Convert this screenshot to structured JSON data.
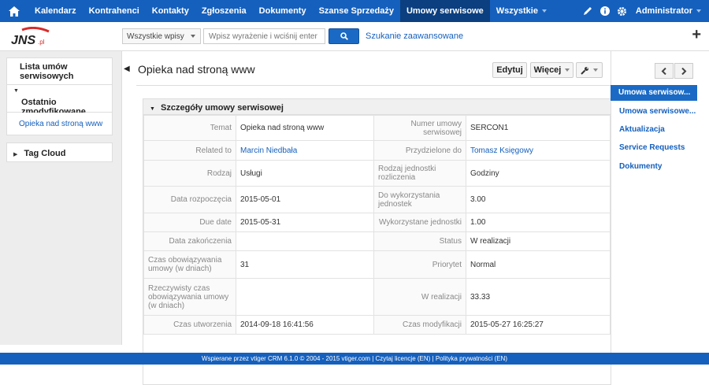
{
  "nav": {
    "items": [
      "Kalendarz",
      "Kontrahenci",
      "Kontakty",
      "Zgłoszenia",
      "Dokumenty",
      "Szanse Sprzedaży",
      "Umowy serwisowe",
      "Wszystkie"
    ],
    "active": "Umowy serwisowe",
    "admin": "Administrator"
  },
  "search": {
    "select_value": "Wszystkie wpisy",
    "placeholder": "Wpisz wyrażenie i wciśnij enter",
    "advanced": "Szukanie zaawansowane"
  },
  "sidebar": {
    "list_title": "Lista umów serwisowych",
    "recent_title": "Ostatnio zmodyfikowane",
    "recent_items": [
      "Opieka nad stroną www"
    ],
    "tag_cloud": "Tag Cloud"
  },
  "record": {
    "title": "Opieka nad stroną www",
    "edit": "Edytuj",
    "more": "Więcej",
    "block_title": "Szczegóły umowy serwisowej"
  },
  "fields": [
    {
      "l1": "Temat",
      "v1": "Opieka nad stroną www",
      "l2": "Numer umowy serwisowej",
      "v2": "SERCON1"
    },
    {
      "l1": "Related to",
      "v1": "Marcin Niedbała",
      "l2": "Przydzielone do",
      "v2": "Tomasz Księgowy"
    },
    {
      "l1": "Rodzaj",
      "v1": "Usługi",
      "l2": "Rodzaj jednostki rozliczenia",
      "v2": "Godziny"
    },
    {
      "l1": "Data rozpoczęcia",
      "v1": "2015-05-01",
      "l2": "Do wykorzystania jednostek",
      "v2": "3.00"
    },
    {
      "l1": "Due date",
      "v1": "2015-05-31",
      "l2": "Wykorzystane jednostki",
      "v2": "1.00"
    },
    {
      "l1": "Data zakończenia",
      "v1": "",
      "l2": "Status",
      "v2": "W realizacji"
    },
    {
      "l1": "Czas obowiązywania umowy (w dniach)",
      "v1": "31",
      "l2": "Priorytet",
      "v2": "Normal"
    },
    {
      "l1": "Rzeczywisty czas obowiązywania umowy (w dniach)",
      "v1": "",
      "l2": "W realizacji",
      "v2": "33.33"
    },
    {
      "l1": "Czas utworzenia",
      "v1": "2014-09-18 16:41:56",
      "l2": "Czas modyfikacji",
      "v2": "2015-05-27 16:25:27"
    }
  ],
  "right_nav": [
    "Umowa serwisow...",
    "Umowa serwisowe...",
    "Aktualizacja",
    "Service Requests",
    "Dokumenty"
  ],
  "footer": "Wspierane przez vtiger CRM 6.1.0  © 2004 - 2015  vtiger.com | Czytaj licencje (EN) | Polityka prywatności (EN)",
  "colors": {
    "brand": "#1560bd",
    "active_nav": "#0b3f80"
  }
}
